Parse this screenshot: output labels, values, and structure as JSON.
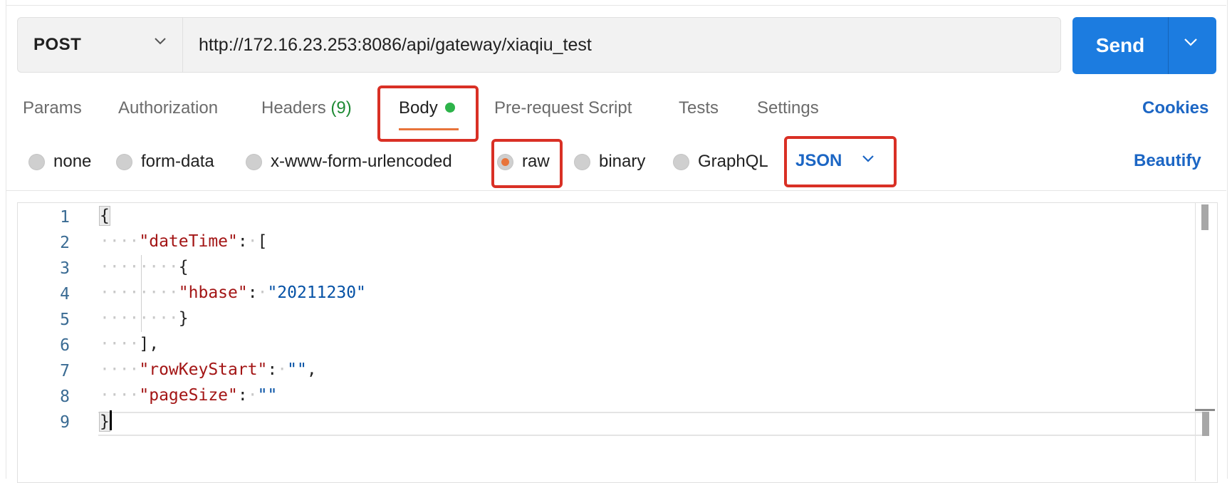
{
  "request": {
    "method": "POST",
    "url": "http://172.16.23.253:8086/api/gateway/xiaqiu_test",
    "send_label": "Send"
  },
  "tabs": [
    {
      "label": "Params"
    },
    {
      "label": "Authorization"
    },
    {
      "label": "Headers",
      "count": "(9)"
    },
    {
      "label": "Body",
      "active": true
    },
    {
      "label": "Pre-request Script"
    },
    {
      "label": "Tests"
    },
    {
      "label": "Settings"
    }
  ],
  "cookies_label": "Cookies",
  "body_types": [
    {
      "label": "none"
    },
    {
      "label": "form-data"
    },
    {
      "label": "x-www-form-urlencoded"
    },
    {
      "label": "raw",
      "selected": true
    },
    {
      "label": "binary"
    },
    {
      "label": "GraphQL"
    }
  ],
  "format": "JSON",
  "beautify_label": "Beautify",
  "editor": {
    "line_numbers": [
      "1",
      "2",
      "3",
      "4",
      "5",
      "6",
      "7",
      "8",
      "9"
    ],
    "code": {
      "open": "{",
      "key_datetime": "\"dateTime\"",
      "open_arr": "[",
      "inner_open": "{",
      "key_hbase": "\"hbase\"",
      "val_hbase": "\"20211230\"",
      "inner_close": "}",
      "close_arr": "],",
      "key_rowkey": "\"rowKeyStart\"",
      "val_rowkey": "\"\"",
      "key_pagesize": "\"pageSize\"",
      "val_pagesize": "\"\"",
      "close": "}"
    }
  },
  "colors": {
    "send": "#1c7ce0",
    "accent_orange": "#e8743b",
    "link_blue": "#1c66c4",
    "highlight_red": "#d93025",
    "status_green": "#2db34a"
  }
}
